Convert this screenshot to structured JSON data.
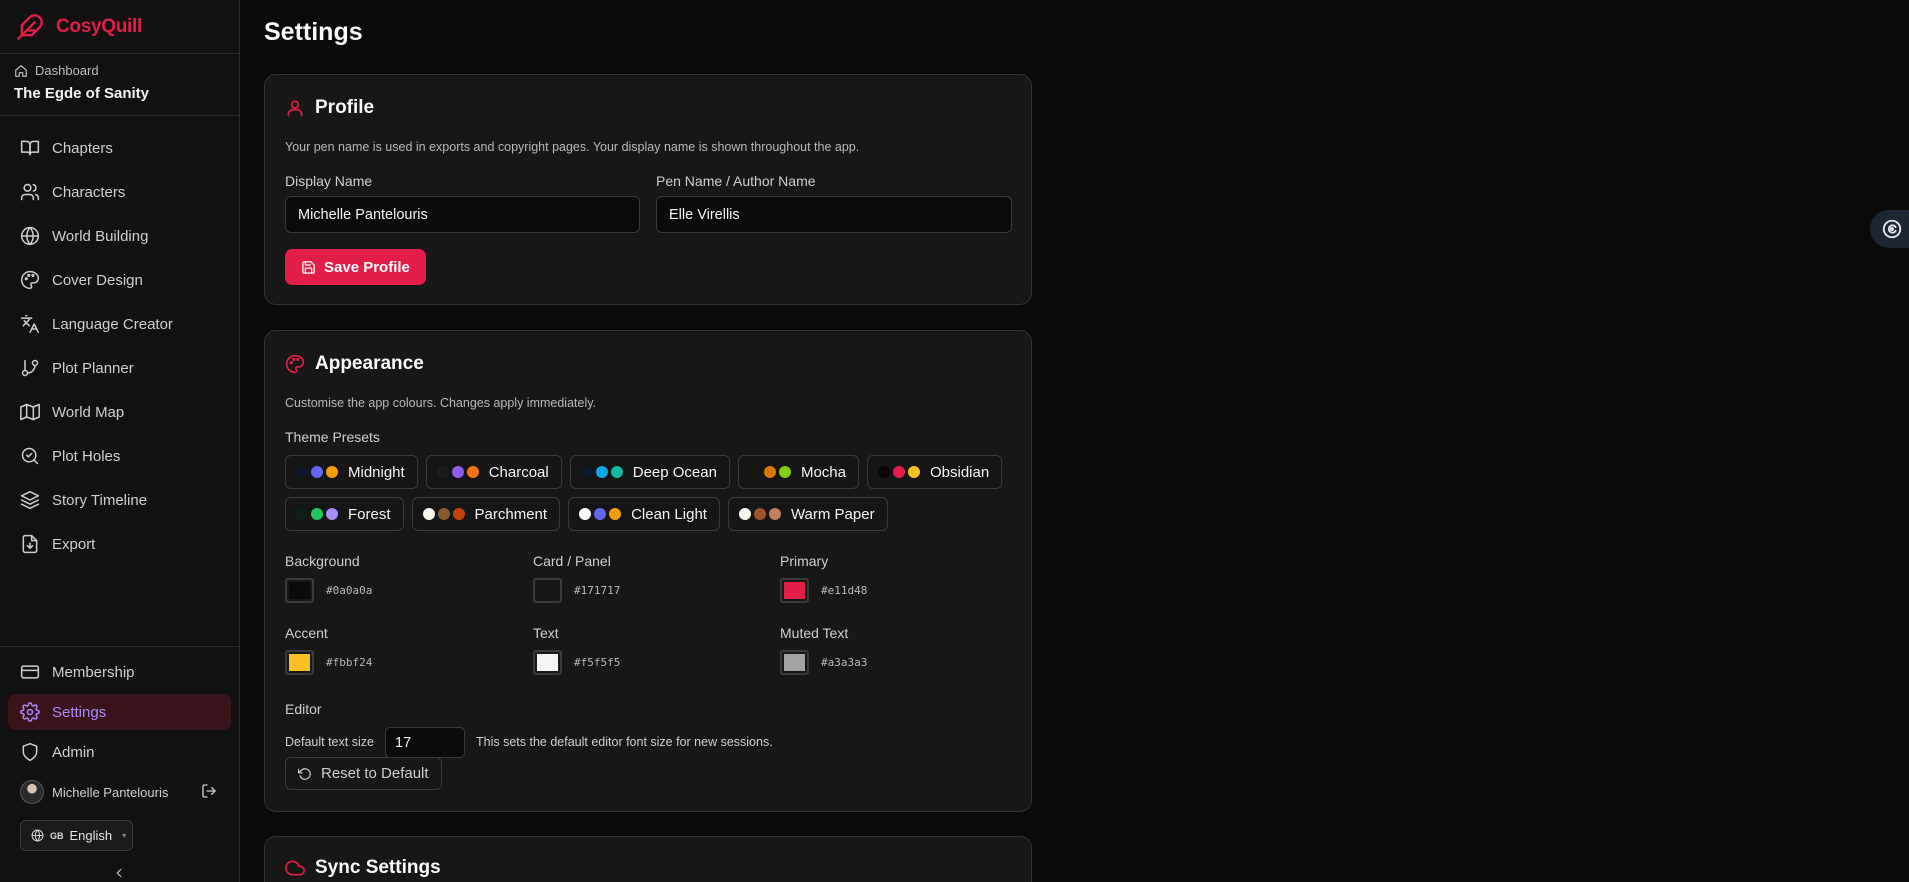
{
  "app": {
    "brand": "CosyQuill"
  },
  "sidebar": {
    "breadcrumb": "Dashboard",
    "project_title": "The Egde of Sanity",
    "items": [
      {
        "label": "Chapters",
        "icon": "book-open-icon"
      },
      {
        "label": "Characters",
        "icon": "users-icon"
      },
      {
        "label": "World Building",
        "icon": "globe-icon"
      },
      {
        "label": "Cover Design",
        "icon": "palette-icon"
      },
      {
        "label": "Language Creator",
        "icon": "languages-icon"
      },
      {
        "label": "Plot Planner",
        "icon": "git-branch-icon"
      },
      {
        "label": "World Map",
        "icon": "map-icon"
      },
      {
        "label": "Plot Holes",
        "icon": "search-check-icon"
      },
      {
        "label": "Story Timeline",
        "icon": "layers-icon"
      },
      {
        "label": "Export",
        "icon": "file-export-icon"
      }
    ],
    "bottom_items": [
      {
        "label": "Membership",
        "icon": "credit-card-icon"
      },
      {
        "label": "Settings",
        "icon": "gear-icon",
        "active": true
      },
      {
        "label": "Admin",
        "icon": "shield-icon"
      }
    ],
    "user_name": "Michelle Pantelouris",
    "language": {
      "flag": "GB",
      "label": "English"
    }
  },
  "page": {
    "title": "Settings"
  },
  "profile": {
    "title": "Profile",
    "description": "Your pen name is used in exports and copyright pages. Your display name is shown throughout the app.",
    "display_name_label": "Display Name",
    "display_name_value": "Michelle Pantelouris",
    "pen_name_label": "Pen Name / Author Name",
    "pen_name_value": "Elle Virellis",
    "save_label": "Save Profile"
  },
  "appearance": {
    "title": "Appearance",
    "description": "Customise the app colours. Changes apply immediately.",
    "presets_label": "Theme Presets",
    "presets": [
      {
        "name": "Midnight",
        "dots": [
          "#0f172a",
          "#6366f1",
          "#f59e0b"
        ]
      },
      {
        "name": "Charcoal",
        "dots": [
          "#1c1c1c",
          "#8b5cf6",
          "#f97316"
        ]
      },
      {
        "name": "Deep Ocean",
        "dots": [
          "#0c1a2a",
          "#0ea5e9",
          "#14b8a6"
        ]
      },
      {
        "name": "Mocha",
        "dots": [
          "#1c1410",
          "#d97706",
          "#84cc16"
        ]
      },
      {
        "name": "Obsidian",
        "dots": [
          "#050505",
          "#e11d48",
          "#fbbf24"
        ]
      },
      {
        "name": "Forest",
        "dots": [
          "#0f1f14",
          "#22c55e",
          "#a78bfa"
        ]
      },
      {
        "name": "Parchment",
        "dots": [
          "#faf6ec",
          "#8b5a2b",
          "#c2410c"
        ]
      },
      {
        "name": "Clean Light",
        "dots": [
          "#ffffff",
          "#6366f1",
          "#f59e0b"
        ]
      },
      {
        "name": "Warm Paper",
        "dots": [
          "#fbf7ef",
          "#a0522d",
          "#c08060"
        ]
      }
    ],
    "colors": [
      {
        "label": "Background",
        "hex": "#0a0a0a"
      },
      {
        "label": "Card / Panel",
        "hex": "#171717"
      },
      {
        "label": "Primary",
        "hex": "#e11d48"
      },
      {
        "label": "Accent",
        "hex": "#fbbf24"
      },
      {
        "label": "Text",
        "hex": "#f5f5f5"
      },
      {
        "label": "Muted Text",
        "hex": "#a3a3a3"
      }
    ],
    "editor_label": "Editor",
    "text_size_label": "Default text size",
    "text_size_value": "17",
    "text_size_hint": "This sets the default editor font size for new sessions.",
    "reset_label": "Reset to Default"
  },
  "sync": {
    "title": "Sync Settings"
  }
}
